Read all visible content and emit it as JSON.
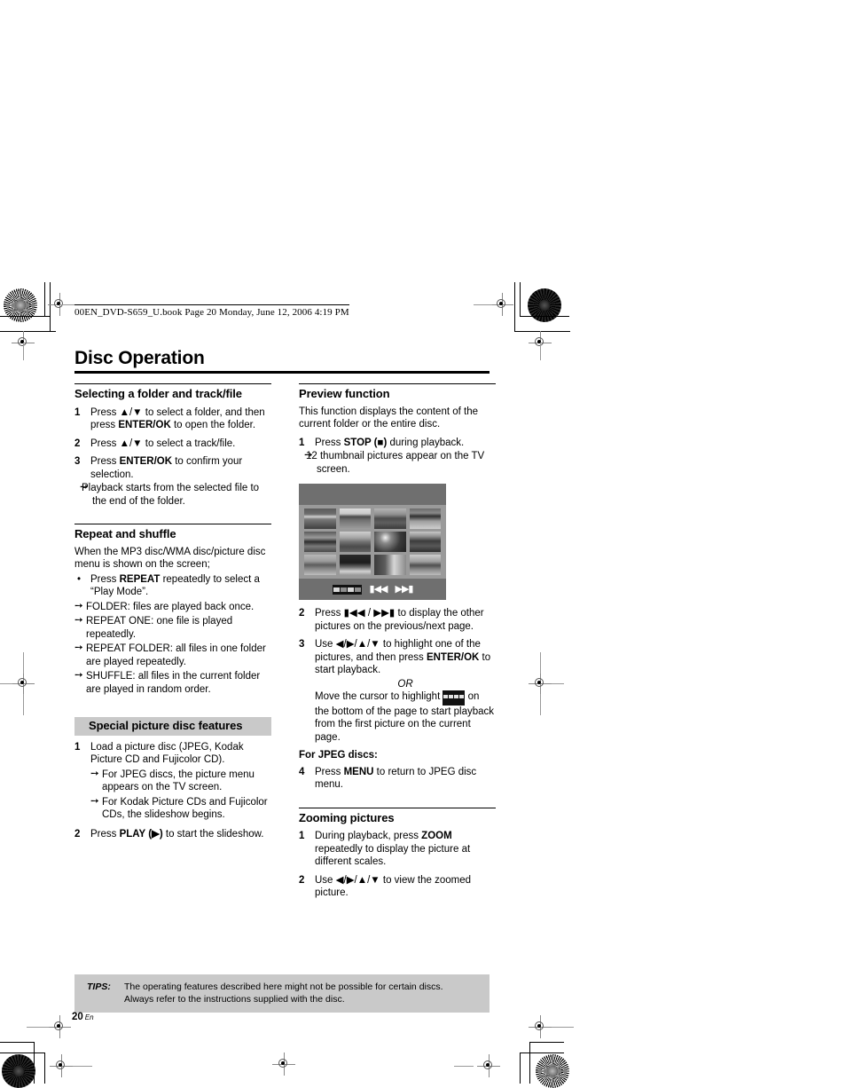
{
  "header": {
    "filename_line": "00EN_DVD-S659_U.book  Page 20  Monday, June 12, 2006  4:19 PM"
  },
  "page_title": "Disc Operation",
  "left_column": {
    "section1": {
      "heading": "Selecting a folder and track/file",
      "steps": [
        {
          "num": "1",
          "text_parts": [
            "Press ",
            "▲/▼",
            " to select a folder, and then press ",
            "ENTER/OK",
            " to open the folder."
          ],
          "text": "Press ▲/▼ to select a folder, and then press ENTER/OK to open the folder."
        },
        {
          "num": "2",
          "text": "Press ▲/▼ to select a track/file."
        },
        {
          "num": "3",
          "text": "Press ENTER/OK to confirm your selection.",
          "arrows": [
            "Playback starts from the selected file to the end of the folder."
          ]
        }
      ]
    },
    "section2": {
      "heading": "Repeat and shuffle",
      "intro": "When the MP3 disc/WMA disc/picture disc menu is shown on the screen;",
      "bullet": "Press REPEAT repeatedly to select a “Play Mode”.",
      "arrows": [
        "FOLDER: files are played back once.",
        "REPEAT ONE: one file is played repeatedly.",
        "REPEAT FOLDER: all files in one folder are played repeatedly.",
        "SHUFFLE: all files in the current folder are played in random order."
      ]
    },
    "section3": {
      "heading": "Special picture disc features",
      "steps": [
        {
          "num": "1",
          "text": "Load a picture disc (JPEG, Kodak Picture CD and Fujicolor CD).",
          "arrows": [
            "For JPEG discs, the picture menu appears on the TV screen.",
            "For Kodak Picture CDs and Fujicolor CDs, the slideshow begins."
          ]
        },
        {
          "num": "2",
          "text": "Press PLAY (▶) to start the slideshow."
        }
      ]
    }
  },
  "right_column": {
    "section1": {
      "heading": "Preview function",
      "intro": "This function displays the content of the current folder or the entire disc.",
      "step1": {
        "num": "1",
        "text": "Press STOP (■) during playback.",
        "arrow": "12 thumbnail pictures appear on the TV screen."
      },
      "tv_preview": {
        "thumbnail_count": 12,
        "rows": 3,
        "cols": 4,
        "filmstrip_icon": "filmstrip-icon",
        "prev_label": "◀◀",
        "next_label": "▶▶"
      },
      "step2": {
        "num": "2",
        "text": "Press ⏮◀◀ / ▶▶⏭ to display the other pictures on the previous/next page."
      },
      "step3": {
        "num": "3",
        "text": "Use ◀/▶/▲/▼ to highlight one of the pictures, and then press ENTER/OK to start playback.",
        "or_label": "OR",
        "or_text_before": "Move the cursor to highlight ",
        "or_text_after": " on the bottom of the page to start playback from the first picture on the current page."
      },
      "jpeg_label": "For JPEG discs:",
      "step4": {
        "num": "4",
        "text": "Press MENU to return to JPEG disc menu."
      }
    },
    "section2": {
      "heading": "Zooming pictures",
      "steps": [
        {
          "num": "1",
          "text": "During playback, press ZOOM repeatedly to display the picture at different scales."
        },
        {
          "num": "2",
          "text": "Use ◀/▶/▲/▼ to view the zoomed picture."
        }
      ]
    }
  },
  "tips": {
    "label": "TIPS:",
    "line1": "The operating features described here might not be possible for certain discs.",
    "line2": "Always refer to the instructions supplied with the disc."
  },
  "folio": {
    "page_number": "20",
    "language": "En"
  },
  "colors": {
    "gray_band": "#c9c9c9",
    "tv_background": "#7b7b7b",
    "tv_grid_background": "#9a9a9a",
    "rule": "#000000"
  }
}
